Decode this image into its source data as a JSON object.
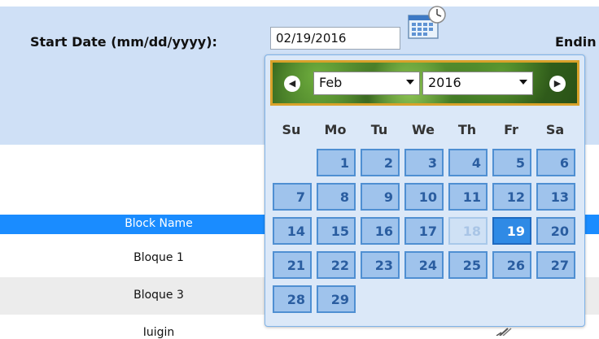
{
  "form": {
    "start_label": "Start Date (mm/dd/yyyy):",
    "start_value": "02/19/2016",
    "ending_label": "Endin"
  },
  "datepicker": {
    "prev_icon": "◀",
    "next_icon": "▶",
    "month": "Feb",
    "year": "2016",
    "weekdays": [
      "Su",
      "Mo",
      "Tu",
      "We",
      "Th",
      "Fr",
      "Sa"
    ],
    "days": [
      "1",
      "2",
      "3",
      "4",
      "5",
      "6",
      "7",
      "8",
      "9",
      "10",
      "11",
      "12",
      "13",
      "14",
      "15",
      "16",
      "17",
      "18",
      "19",
      "20",
      "21",
      "22",
      "23",
      "24",
      "25",
      "26",
      "27",
      "28",
      "29"
    ],
    "disabled_day": "18",
    "selected_day": "19",
    "colors": {
      "day_bg": "#9fc3ec",
      "day_border": "#4f8fd2",
      "selected_bg": "#2f8ae5",
      "header_border": "#d9a22a"
    }
  },
  "table": {
    "header": "Block Name",
    "rows": [
      "Bloque 1",
      "Bloque 3",
      "Iuigin"
    ]
  },
  "colors": {
    "panel_bg": "#cfe0f6",
    "table_header_bg": "#1a8cff"
  }
}
